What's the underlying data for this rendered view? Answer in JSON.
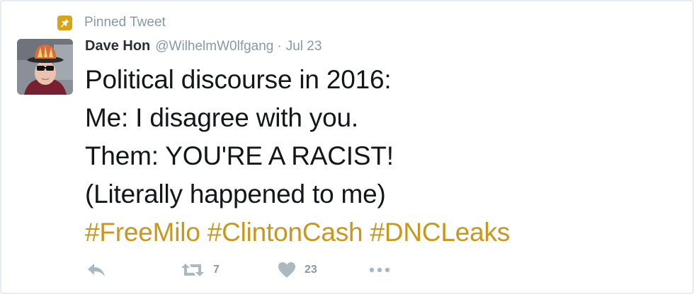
{
  "pinned": {
    "label": "Pinned Tweet"
  },
  "author": {
    "display_name": "Dave Hon",
    "handle": "@WilhelmW0lfgang",
    "separator": "·",
    "date": "Jul 23"
  },
  "tweet": {
    "lines": [
      "Political discourse in 2016:",
      "Me: I disagree with you.",
      "Them: YOU'RE A RACIST!",
      "(Literally happened to me)"
    ],
    "hashtags": [
      "#FreeMilo",
      "#ClintonCash",
      "#DNCLeaks"
    ]
  },
  "actions": {
    "reply_icon": "reply-icon",
    "retweet_icon": "retweet-icon",
    "retweet_count": "7",
    "like_icon": "heart-icon",
    "like_count": "23",
    "more_icon": "more-icon"
  },
  "colors": {
    "accent": "#c9971c",
    "pin_badge": "#d9a516",
    "muted": "#8899a6",
    "text": "#14171a",
    "border": "#e6ecf0"
  }
}
